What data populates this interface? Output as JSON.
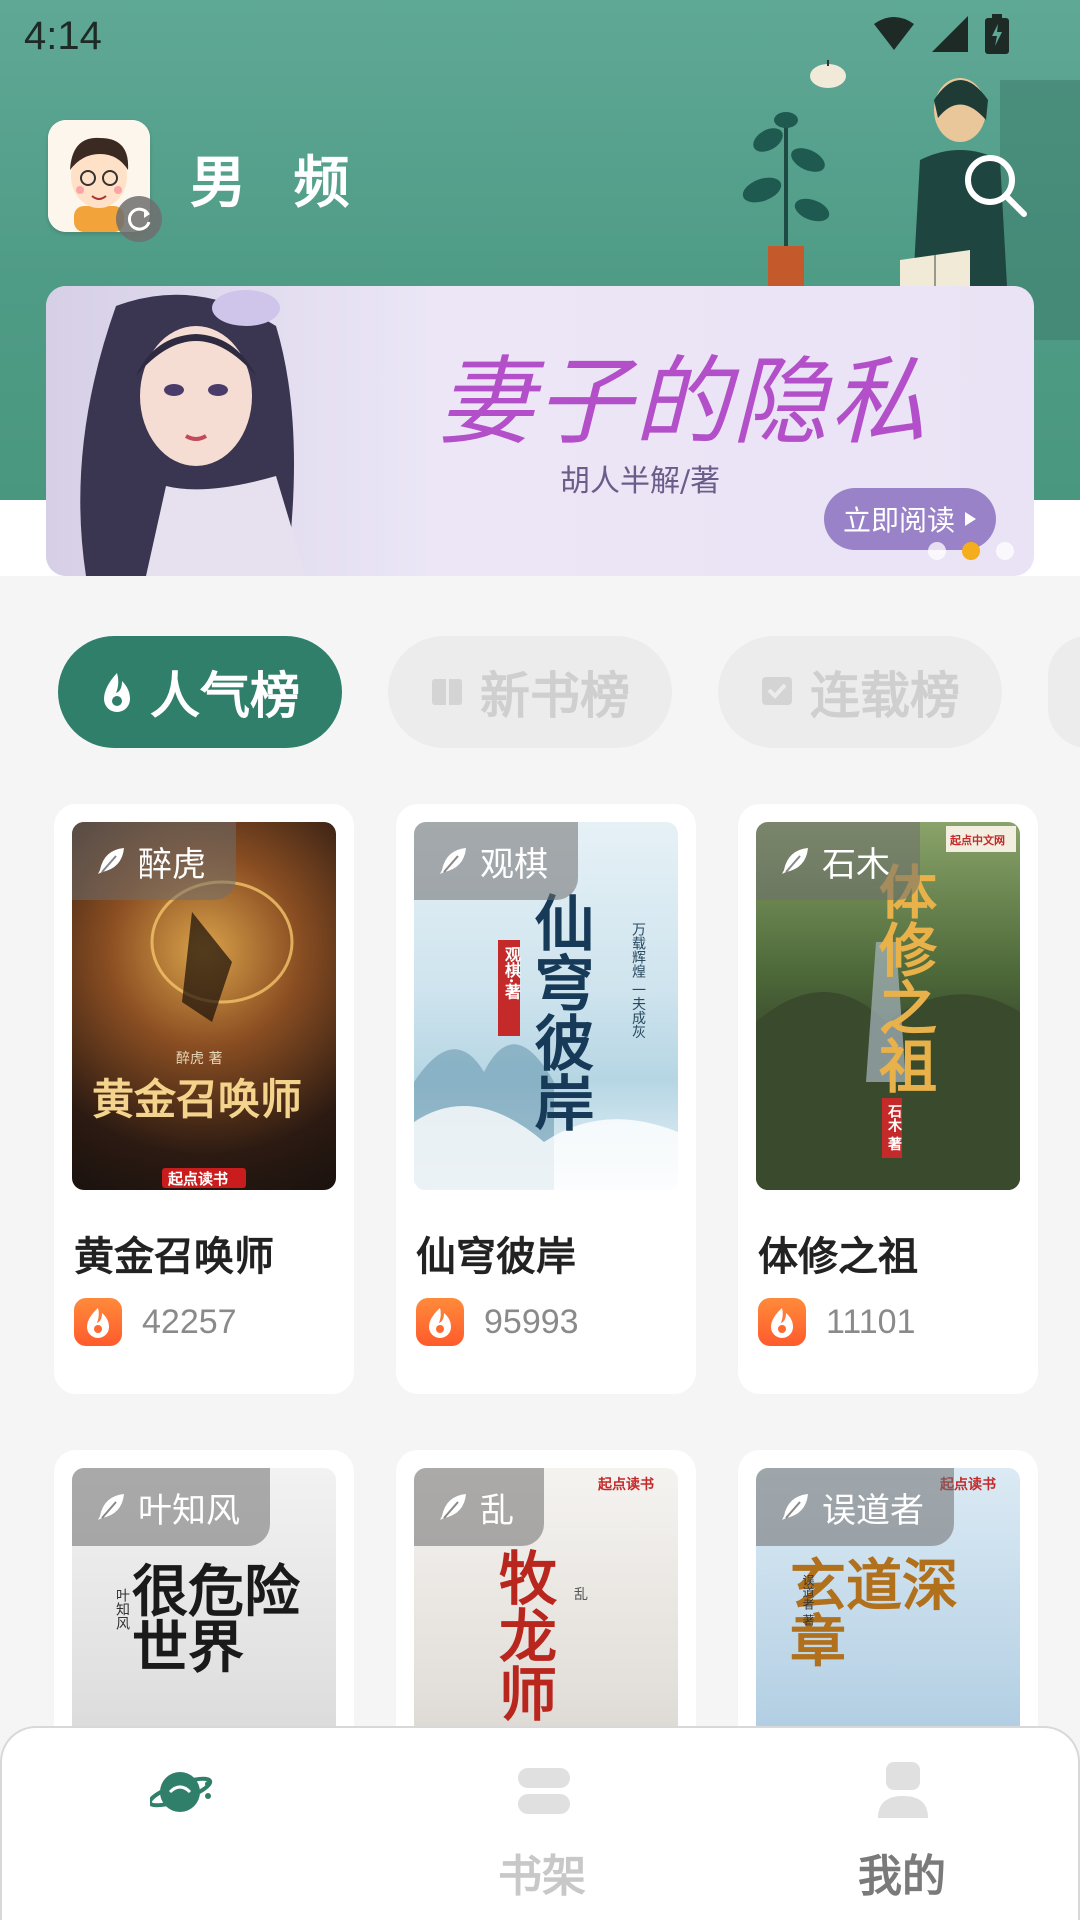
{
  "status_bar": {
    "time": "4:14"
  },
  "header": {
    "channel_label": "男 频"
  },
  "banner": {
    "title": "妻子的隐私",
    "author": "胡人半解/著",
    "read_button": "立即阅读",
    "dots": 3,
    "active_dot": 2
  },
  "tabs": [
    {
      "label": "人气榜",
      "active": true
    },
    {
      "label": "新书榜",
      "active": false
    },
    {
      "label": "连载榜",
      "active": false
    }
  ],
  "books": [
    {
      "author": "醉虎",
      "title": "黄金召唤师",
      "heat": "42257",
      "cover_text": "黄金召唤师",
      "cover_author": "醉虎 著",
      "cover_brand": "起点读书"
    },
    {
      "author": "观棋",
      "title": "仙穹彼岸",
      "heat": "95993",
      "cover_text": "仙穹彼岸",
      "cover_author": "观棋·著",
      "cover_brand": "万载辉煌 一夫成灰"
    },
    {
      "author": "石木",
      "title": "体修之祖",
      "heat": "11101",
      "cover_text": "体修之祖",
      "cover_author": "石木 著",
      "cover_brand": "起点中文网"
    },
    {
      "author": "叶知风",
      "title": "",
      "heat": "",
      "cover_text": "很危险世界",
      "cover_author": "叶知风",
      "cover_brand": ""
    },
    {
      "author": "乱",
      "title": "",
      "heat": "",
      "cover_text": "牧龙师",
      "cover_author": "乱",
      "cover_brand": "起点读书"
    },
    {
      "author": "误道者",
      "title": "",
      "heat": "",
      "cover_text": "玄道深章",
      "cover_author": "误道者 著",
      "cover_brand": "起点读书"
    }
  ],
  "bottom_nav": [
    {
      "label": "",
      "icon": "planet-icon",
      "active": true
    },
    {
      "label": "书架",
      "icon": "bookshelf-icon",
      "active": false
    },
    {
      "label": "我的",
      "icon": "profile-icon",
      "active": false
    }
  ],
  "colors": {
    "header_green": "#4f9c86",
    "tab_active": "#2f7f6a",
    "banner_title": "#b24fc9",
    "dot_active": "#f4ad1c"
  }
}
